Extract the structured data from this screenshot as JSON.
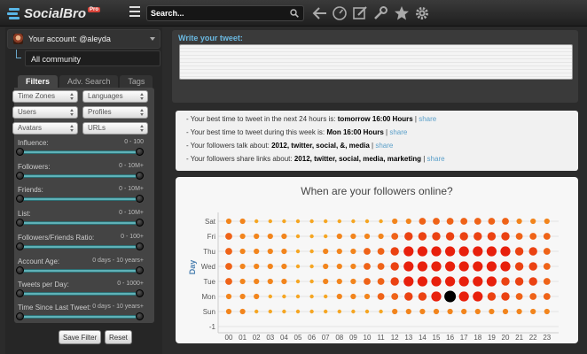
{
  "app": {
    "name": "SocialBro",
    "badge": "Pro"
  },
  "topbar": {
    "search_placeholder": "Search...",
    "icons": [
      "menu-icon",
      "search-icon",
      "back-arrow-icon",
      "dashboard-icon",
      "compose-icon",
      "wrench-icon",
      "star-icon",
      "gear-icon"
    ]
  },
  "sidebar": {
    "account_label": "Your account: @aleyda",
    "community_label": "All community",
    "tabs": [
      {
        "label": "Filters",
        "active": true
      },
      {
        "label": "Adv. Search",
        "active": false
      },
      {
        "label": "Tags",
        "active": false
      }
    ],
    "dropdowns": [
      "Time Zones",
      "Languages",
      "Users",
      "Profiles",
      "Avatars",
      "URLs"
    ],
    "sliders": [
      {
        "label": "Influence:",
        "range": "0 - 100"
      },
      {
        "label": "Followers:",
        "range": "0 - 10M+"
      },
      {
        "label": "Friends:",
        "range": "0 - 10M+"
      },
      {
        "label": "List:",
        "range": "0 - 10M+"
      },
      {
        "label": "Followers/Friends Ratio:",
        "range": "0 - 100+"
      },
      {
        "label": "Account Age:",
        "range": "0 days - 10 years+"
      },
      {
        "label": "Tweets per Day:",
        "range": "0 - 1000+"
      },
      {
        "label": "Time Since Last Tweet:",
        "range": "0 days - 10 years+"
      }
    ],
    "save_label": "Save Filter",
    "reset_label": "Reset"
  },
  "compose": {
    "label": "Write your tweet:"
  },
  "tips": [
    {
      "text": "- Your best time to tweet in the next 24 hours is: ",
      "bold": "tomorrow 16:00 Hours",
      "link": "share"
    },
    {
      "text": "- Your best time to tweet during this week is: ",
      "bold": "Mon 16:00 Hours",
      "link": "share"
    },
    {
      "text": "- Your followers talk about: ",
      "bold": "2012, twitter, social, &, media",
      "link": "share"
    },
    {
      "text": "- Your followers share links about: ",
      "bold": "2012, twitter, social, media, marketing",
      "link": "share"
    }
  ],
  "chart_data": {
    "type": "scatter",
    "title": "When are your followers online?",
    "ylabel": "Day",
    "xlabel": "",
    "x": [
      "00",
      "01",
      "02",
      "03",
      "04",
      "05",
      "06",
      "07",
      "08",
      "09",
      "10",
      "11",
      "12",
      "13",
      "14",
      "15",
      "16",
      "17",
      "18",
      "19",
      "20",
      "21",
      "22",
      "23"
    ],
    "y": [
      "Sat",
      "Fri",
      "Thu",
      "Wed",
      "Tue",
      "Mon",
      "Sun",
      "-1"
    ],
    "series": [
      {
        "day": "Sat",
        "values": [
          2,
          2,
          1,
          1,
          1,
          1,
          1,
          1,
          1,
          1,
          1,
          1,
          2,
          2,
          3,
          3,
          3,
          3,
          3,
          3,
          3,
          2,
          2,
          2
        ]
      },
      {
        "day": "Fri",
        "values": [
          3,
          2,
          2,
          2,
          2,
          1,
          1,
          1,
          2,
          2,
          2,
          2,
          3,
          4,
          4,
          4,
          4,
          4,
          4,
          4,
          4,
          3,
          3,
          3
        ]
      },
      {
        "day": "Thu",
        "values": [
          3,
          2,
          2,
          2,
          2,
          1,
          1,
          2,
          2,
          2,
          3,
          3,
          4,
          5,
          5,
          5,
          5,
          5,
          5,
          5,
          5,
          4,
          4,
          3
        ]
      },
      {
        "day": "Wed",
        "values": [
          3,
          2,
          2,
          2,
          2,
          1,
          1,
          2,
          2,
          2,
          3,
          3,
          4,
          5,
          5,
          5,
          5,
          5,
          5,
          5,
          5,
          4,
          4,
          3
        ]
      },
      {
        "day": "Tue",
        "values": [
          3,
          2,
          2,
          2,
          2,
          1,
          1,
          2,
          2,
          2,
          3,
          3,
          4,
          5,
          5,
          5,
          5,
          5,
          5,
          5,
          4,
          4,
          4,
          3
        ]
      },
      {
        "day": "Mon",
        "values": [
          2,
          2,
          2,
          1,
          1,
          1,
          1,
          1,
          2,
          2,
          2,
          3,
          3,
          4,
          4,
          5,
          6,
          5,
          5,
          4,
          4,
          3,
          3,
          3
        ]
      },
      {
        "day": "Sun",
        "values": [
          2,
          2,
          1,
          1,
          1,
          1,
          1,
          1,
          1,
          1,
          1,
          1,
          2,
          2,
          2,
          2,
          2,
          2,
          2,
          2,
          2,
          2,
          2,
          2
        ]
      }
    ],
    "colors": {
      "low": "#f5a623",
      "high": "#e8200c",
      "peak": "#000000"
    },
    "peak": {
      "day": "Mon",
      "hour": "16"
    }
  }
}
